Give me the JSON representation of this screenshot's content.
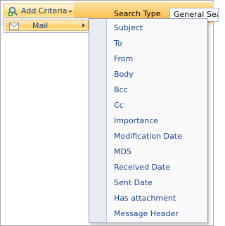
{
  "toolbar": {
    "add_criteria_label": "Add Criteria",
    "add_criteria_icon": "add-search-icon",
    "search_type_label": "Search Type",
    "search_type_value": "General Search"
  },
  "menu": {
    "mail_label": "Mail",
    "mail_icon": "mail-envelope-icon"
  },
  "submenu": {
    "items": [
      "Subject",
      "To",
      "From",
      "Body",
      "Bcc",
      "Cc",
      "Importance",
      "Modification Date",
      "MD5",
      "Received Date",
      "Sent Date",
      "Has attachment",
      "Message Header"
    ]
  },
  "colors": {
    "accent_orange": "#fbc865",
    "menu_text": "#15428b",
    "highlight": "#ffd77e"
  }
}
